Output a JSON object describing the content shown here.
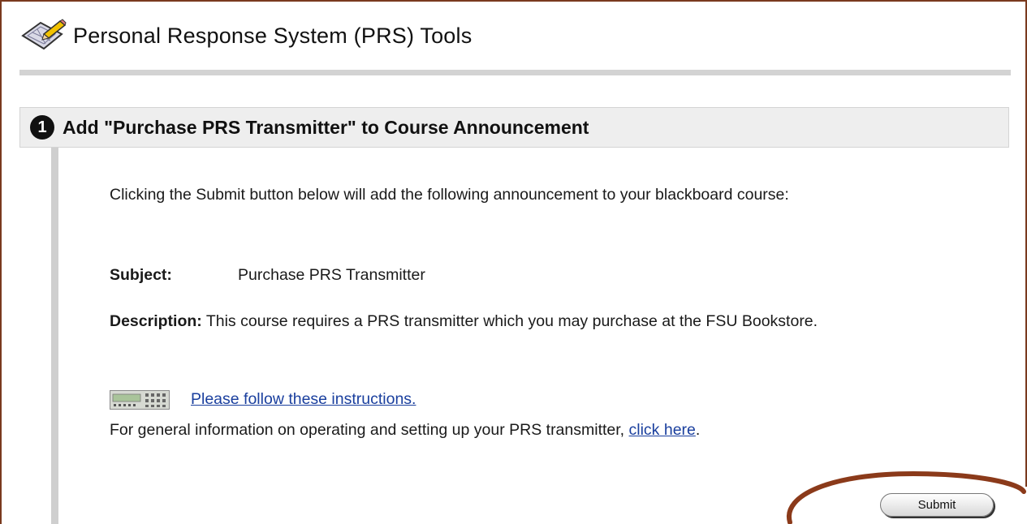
{
  "page": {
    "title": "Personal Response System (PRS) Tools",
    "icon": "tool-palette-pencil-icon"
  },
  "section": {
    "step_number": "1",
    "title": "Add \"Purchase PRS Transmitter\" to Course Announcement"
  },
  "content": {
    "intro": "Clicking the Submit button below will add the following announcement to your blackboard course:",
    "subject_label": "Subject:",
    "subject_value": "Purchase PRS Transmitter",
    "description_label": "Description:",
    "description_value": "This course requires a PRS transmitter which you may purchase at the FSU Bookstore.",
    "instructions_icon": "prs-remote-icon",
    "instructions_link": "Please follow these instructions.",
    "general_info_prefix": "For general information on operating and setting up your PRS transmitter, ",
    "general_info_link": "click here",
    "general_info_suffix": "."
  },
  "actions": {
    "submit_label": "Submit"
  },
  "colors": {
    "frame": "#7a3a1e",
    "highlight": "#8b3a1a",
    "link": "#1a3f9e",
    "section_bg": "#eeeeee"
  }
}
